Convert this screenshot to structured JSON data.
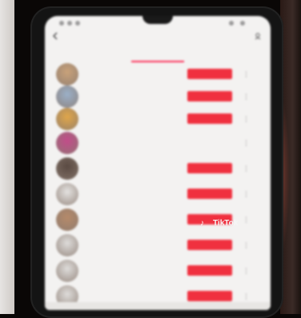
{
  "scene": {
    "description_colors": {
      "surround": "#0a0706",
      "screen_bg": "#f3f2f1",
      "accent": "#f0303f"
    }
  },
  "header": {
    "title": ""
  },
  "tabs": [
    {
      "label": "",
      "active": false
    },
    {
      "label": "",
      "active": true
    },
    {
      "label": "",
      "active": false
    }
  ],
  "rows": [
    {
      "name": "",
      "sub": "",
      "button": "",
      "button_style": "follow",
      "avatar_color": "#c9a27a"
    },
    {
      "name": "",
      "sub": "",
      "button": "",
      "button_style": "follow",
      "avatar_color": "#9bb0c8"
    },
    {
      "name": "",
      "sub": "",
      "button": "",
      "button_style": "follow",
      "avatar_color": "#e0a64a"
    },
    {
      "name": "",
      "sub": "",
      "button": "",
      "button_style": "plain",
      "avatar_color": "#c24c8a"
    },
    {
      "name": "",
      "sub": "",
      "button": "",
      "button_style": "follow",
      "avatar_color": "#5a4a42"
    },
    {
      "name": "",
      "sub": "",
      "button": "",
      "button_style": "follow",
      "avatar_color": "#e4e2e0"
    },
    {
      "name": "",
      "sub": "",
      "button": "",
      "button_style": "follow",
      "avatar_color": "#b58a6a"
    },
    {
      "name": "",
      "sub": "",
      "button": "",
      "button_style": "follow",
      "avatar_color": "#dedcda"
    },
    {
      "name": "",
      "sub": "",
      "button": "",
      "button_style": "follow",
      "avatar_color": "#dedcda"
    },
    {
      "name": "",
      "sub": "",
      "button": "",
      "button_style": "follow",
      "avatar_color": "#dedcda"
    }
  ],
  "watermark": {
    "logo_icon": "tiktok-note-icon",
    "brand": "TikTok",
    "username": ""
  }
}
